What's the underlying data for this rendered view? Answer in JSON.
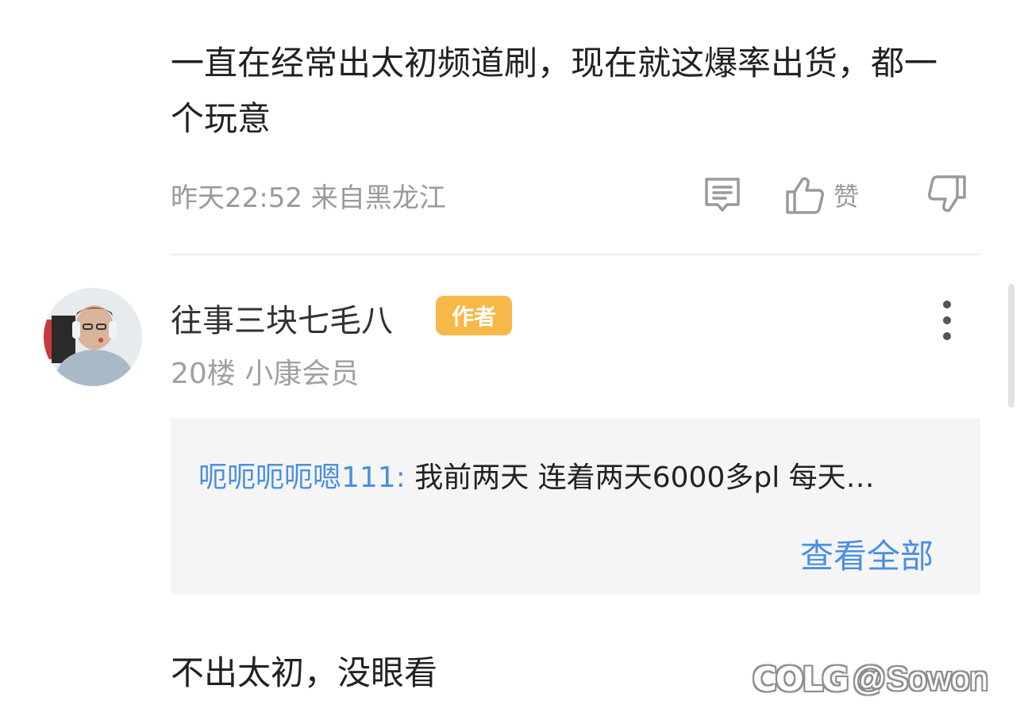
{
  "previous_comment": {
    "content": "一直在经常出太初频道刷，现在就这爆率出货，都一个玩意",
    "time_location": "昨天22:52 来自黑龙江",
    "like_label": "赞",
    "icons": {
      "comment": "comment-icon",
      "like": "thumbs-up-icon",
      "dislike": "thumbs-down-icon"
    }
  },
  "comment": {
    "username": "往事三块七毛八",
    "badge": "作者",
    "floor_info": "20楼 小康会员",
    "avatar": "avatar",
    "reply_preview": {
      "user": "呃呃呃呃嗯111:",
      "text": "我前两天 连着两天6000多pl  每天…",
      "view_all": "查看全部"
    },
    "content": "不出太初，没眼看"
  },
  "watermark": {
    "logo": "COLG",
    "handle": "@Sowon"
  },
  "colors": {
    "accent_blue": "#4a8fe2",
    "badge_orange": "#f7b84a",
    "text_gray": "#9a9a9a",
    "reply_bg": "#f5f5f5"
  }
}
